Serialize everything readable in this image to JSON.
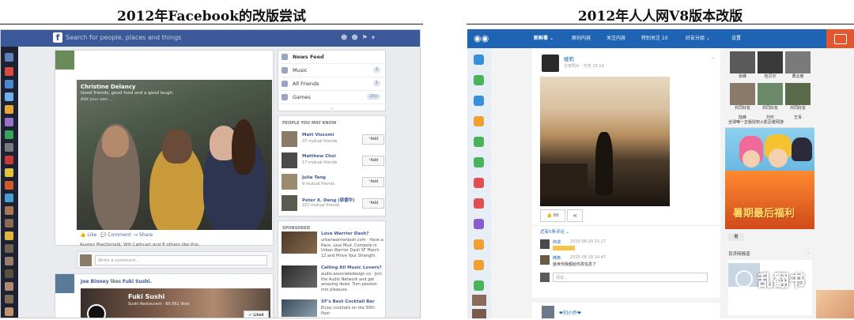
{
  "left_title": "2012年Facebook的改版尝试",
  "right_title": "2012年人人网V8版本改版",
  "facebook": {
    "logo": "f",
    "search_placeholder": "Search for people, places and things",
    "post": {
      "author": "Christine Delancy",
      "text": "Good friends, good food and a good laugh.",
      "meta": "Add your own ...",
      "actions": [
        "Like",
        "Comment",
        "Share"
      ],
      "likes_text": "Austen MacDonald, Will Cathcart and 8 others like this.",
      "comment_placeholder": "Write a comment..."
    },
    "post2": {
      "author": "Joe Binney",
      "verb": " likes ",
      "object": "Fuki Sushi.",
      "page_name": "Fuki Sushi",
      "page_sub": "Sushi Restaurant · 60,061 likes",
      "liked_button": "✓ Liked"
    },
    "sidebar": {
      "items": [
        {
          "label": "News Feed",
          "count": ""
        },
        {
          "label": "Music",
          "count": "1"
        },
        {
          "label": "All Friends",
          "count": "1"
        },
        {
          "label": "Games",
          "count": "20+"
        }
      ],
      "pymk_header": "PEOPLE YOU MAY KNOW",
      "pymk": [
        {
          "name": "Matt Viscomi",
          "mutual": "37 mutual friends",
          "add": "Add"
        },
        {
          "name": "Matthew Choi",
          "mutual": "17 mutual friends",
          "add": "Add"
        },
        {
          "name": "Julia Tang",
          "mutual": "9 mutual friends",
          "add": "Add"
        },
        {
          "name": "Peter X. Deng (郭德华)",
          "mutual": "107 mutual friends",
          "add": "Add"
        }
      ],
      "sponsored_header": "SPONSORED",
      "ads": [
        {
          "title": "Love Warrior Dash?",
          "text": "urbanwarriordash.com · Have a Race. Less Mud. Compete in Urban Warrior Dash SF March 12 and Prove Your Strength."
        },
        {
          "title": "Calling All Music Lovers?",
          "text": "audio.associatedesign.co · Join the Audio Network and get amazing deals. Turn passion into pleasure."
        },
        {
          "title": "SF's Best Cocktail Bar",
          "text": "Enjoy cocktails on the 30th floor"
        }
      ]
    }
  },
  "renren": {
    "nav": [
      "新鲜事",
      "原创内容",
      "关注内容",
      "特别关注 10",
      "好友分组",
      "设置"
    ],
    "post": {
      "author": "楼莉",
      "meta": "分享照片 · 今天 15:14",
      "like_count": "66",
      "comments_header": "近有5条评论",
      "comments": [
        {
          "name": "阿漫",
          "time": "2015-08-29 15:17",
          "text": ""
        },
        {
          "name": "微微",
          "time": "2015-08-29 14:47",
          "text": "盛世你我都给你发信息了"
        }
      ],
      "comment_placeholder": "评论...",
      "next_author": "刘小乔"
    },
    "friends": [
      "张峰",
      "包贝尔",
      "曹云南",
      "共同好友",
      "共同好友",
      "共同好友",
      "陆峰",
      "刘可",
      "王青"
    ],
    "ad_header": "全球唯一正版授权火影忍者网游",
    "ad_banner": "暑期最后福利",
    "ad_button": "看",
    "section2": "百济网报道"
  },
  "watermark": "乱翻书"
}
